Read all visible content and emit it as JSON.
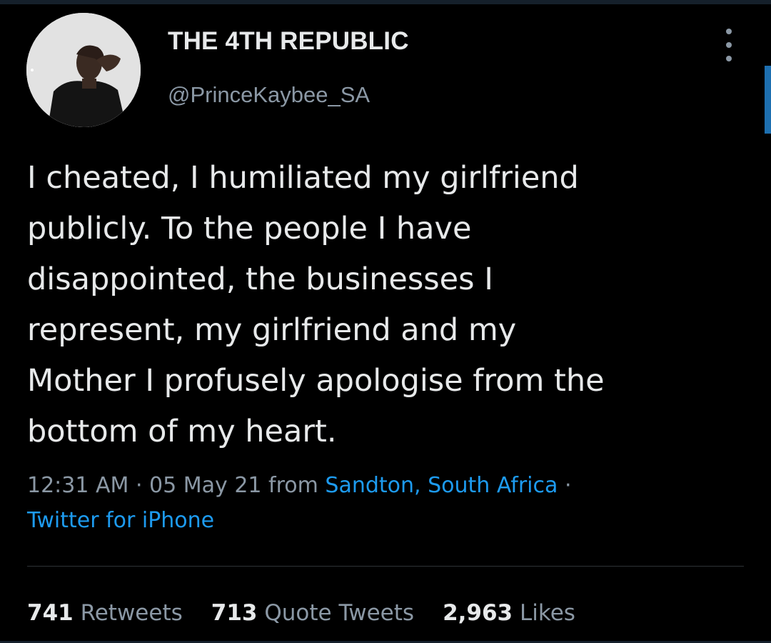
{
  "tweet": {
    "display_name": "THE 4TH REPUBLIC",
    "handle": "@PrinceKaybee_SA",
    "text_lines": [
      "I cheated, I humiliated my girlfriend",
      "publicly. To the people I have",
      "disappointed, the businesses I",
      "represent, my girlfriend and my",
      "Mother I profusely apologise from the",
      "bottom of my heart."
    ],
    "time": "12:31 AM",
    "date": "05 May 21",
    "from_label": "from",
    "location": "Sandton, South Africa",
    "separator": "·",
    "source": "Twitter for iPhone",
    "avatar_icon": "user-photo",
    "more_icon": "more-vertical-icon"
  },
  "stats": {
    "retweets_count": "741",
    "retweets_label": "Retweets",
    "quotes_count": "713",
    "quotes_label": "Quote Tweets",
    "likes_count": "2,963",
    "likes_label": "Likes"
  },
  "colors": {
    "background": "#000000",
    "text": "#e7e9ea",
    "secondary": "#8b98a5",
    "link": "#1d9bf0"
  }
}
